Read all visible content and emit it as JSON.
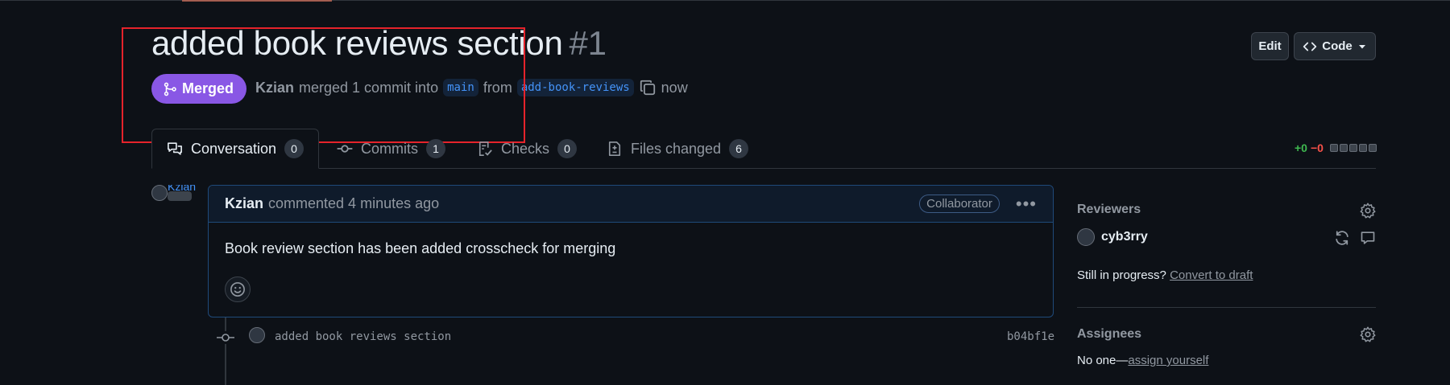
{
  "pr": {
    "title": "added book reviews section",
    "number": "#1",
    "status": "Merged",
    "author": "Kzian",
    "action": "merged 1 commit into",
    "base_branch": "main",
    "from_word": "from",
    "head_branch": "add-book-reviews",
    "time": "now"
  },
  "header_buttons": {
    "edit_label": "Edit",
    "code_label": "Code"
  },
  "tabs": [
    {
      "label": "Conversation",
      "count": "0",
      "icon": "comment-discussion-icon",
      "active": true
    },
    {
      "label": "Commits",
      "count": "1",
      "icon": "commit-icon"
    },
    {
      "label": "Checks",
      "count": "0",
      "icon": "checklist-icon"
    },
    {
      "label": "Files changed",
      "count": "6",
      "icon": "file-diff-icon"
    }
  ],
  "diffstat": {
    "additions": "+0",
    "deletions": "−0"
  },
  "comment": {
    "avatar_alt": "Kzian",
    "author": "Kzian",
    "meta": "commented 4 minutes ago",
    "role_badge": "Collaborator",
    "body": "Book review section has been added crosscheck for merging"
  },
  "commit": {
    "message": "added book reviews section",
    "sha": "b04bf1e"
  },
  "sidebar": {
    "reviewers_heading": "Reviewers",
    "reviewer": "cyb3rry",
    "progress_prompt": "Still in progress?",
    "convert_link": "Convert to draft",
    "assignees_heading": "Assignees",
    "no_one": "No one—",
    "assign_link": "assign yourself"
  },
  "colors": {
    "background": "#0d1117",
    "merged": "#8957e5",
    "link": "#4493f8",
    "additions": "#3fb950",
    "deletions": "#f85149",
    "annotation_box": "#e5232b"
  }
}
